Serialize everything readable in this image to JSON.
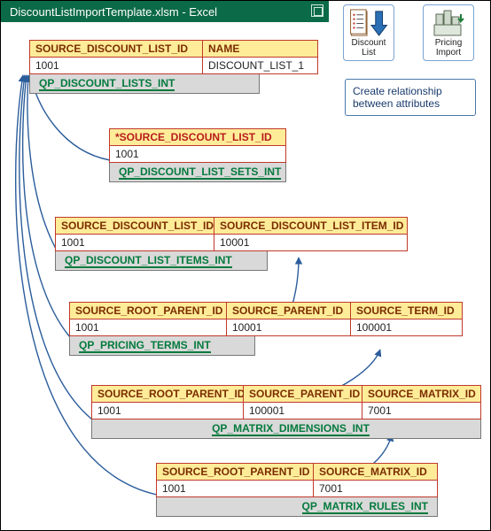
{
  "window": {
    "title": "DiscountListImportTemplate.xlsm - Excel"
  },
  "ribbon": {
    "discount_list": "Discount List",
    "pricing_import_l1": "Pricing",
    "pricing_import_l2": "Import"
  },
  "callout": {
    "line1": "Create relationship",
    "line2": "between attributes"
  },
  "tables": {
    "t1": {
      "h1": "SOURCE_DISCOUNT_LIST_ID",
      "h2": "NAME",
      "v1": "1001",
      "v2": "DISCOUNT_LIST_1",
      "name": "QP_DISCOUNT_LISTS_INT"
    },
    "t2": {
      "h1": "*SOURCE_DISCOUNT_LIST_ID",
      "v1": "1001",
      "name": "QP_DISCOUNT_LIST_SETS_INT"
    },
    "t3": {
      "h1": "SOURCE_DISCOUNT_LIST_ID",
      "h2": "SOURCE_DISCOUNT_LIST_ITEM_ID",
      "v1": "1001",
      "v2": "10001",
      "name": "QP_DISCOUNT_LIST_ITEMS_INT"
    },
    "t4": {
      "h1": "SOURCE_ROOT_PARENT_ID",
      "h2": "SOURCE_PARENT_ID",
      "h3": "SOURCE_TERM_ID",
      "v1": "1001",
      "v2": "10001",
      "v3": "100001",
      "name": "QP_PRICING_TERMS_INT"
    },
    "t5": {
      "h1": "SOURCE_ROOT_PARENT_ID",
      "h2": "SOURCE_PARENT_ID",
      "h3": "SOURCE_MATRIX_ID",
      "v1": "1001",
      "v2": "100001",
      "v3": "7001",
      "name": "QP_MATRIX_DIMENSIONS_INT"
    },
    "t6": {
      "h1": "SOURCE_ROOT_PARENT_ID",
      "h2": "SOURCE_MATRIX_ID",
      "v1": "1001",
      "v2": "7001",
      "name": "QP_MATRIX_RULES_INT"
    }
  },
  "chart_data": {
    "type": "diagram",
    "nodes": [
      {
        "id": "QP_DISCOUNT_LISTS_INT",
        "fields": {
          "SOURCE_DISCOUNT_LIST_ID": "1001",
          "NAME": "DISCOUNT_LIST_1"
        }
      },
      {
        "id": "QP_DISCOUNT_LIST_SETS_INT",
        "fields": {
          "*SOURCE_DISCOUNT_LIST_ID": "1001"
        }
      },
      {
        "id": "QP_DISCOUNT_LIST_ITEMS_INT",
        "fields": {
          "SOURCE_DISCOUNT_LIST_ID": "1001",
          "SOURCE_DISCOUNT_LIST_ITEM_ID": "10001"
        }
      },
      {
        "id": "QP_PRICING_TERMS_INT",
        "fields": {
          "SOURCE_ROOT_PARENT_ID": "1001",
          "SOURCE_PARENT_ID": "10001",
          "SOURCE_TERM_ID": "100001"
        }
      },
      {
        "id": "QP_MATRIX_DIMENSIONS_INT",
        "fields": {
          "SOURCE_ROOT_PARENT_ID": "1001",
          "SOURCE_PARENT_ID": "100001",
          "SOURCE_MATRIX_ID": "7001"
        }
      },
      {
        "id": "QP_MATRIX_RULES_INT",
        "fields": {
          "SOURCE_ROOT_PARENT_ID": "1001",
          "SOURCE_MATRIX_ID": "7001"
        }
      }
    ],
    "edges": [
      {
        "from": "QP_DISCOUNT_LIST_SETS_INT.*SOURCE_DISCOUNT_LIST_ID",
        "to": "QP_DISCOUNT_LISTS_INT.SOURCE_DISCOUNT_LIST_ID"
      },
      {
        "from": "QP_DISCOUNT_LIST_ITEMS_INT.SOURCE_DISCOUNT_LIST_ID",
        "to": "QP_DISCOUNT_LISTS_INT.SOURCE_DISCOUNT_LIST_ID"
      },
      {
        "from": "QP_PRICING_TERMS_INT.SOURCE_ROOT_PARENT_ID",
        "to": "QP_DISCOUNT_LISTS_INT.SOURCE_DISCOUNT_LIST_ID"
      },
      {
        "from": "QP_PRICING_TERMS_INT.SOURCE_PARENT_ID",
        "to": "QP_DISCOUNT_LIST_ITEMS_INT.SOURCE_DISCOUNT_LIST_ITEM_ID"
      },
      {
        "from": "QP_MATRIX_DIMENSIONS_INT.SOURCE_ROOT_PARENT_ID",
        "to": "QP_DISCOUNT_LISTS_INT.SOURCE_DISCOUNT_LIST_ID"
      },
      {
        "from": "QP_MATRIX_DIMENSIONS_INT.SOURCE_PARENT_ID",
        "to": "QP_PRICING_TERMS_INT.SOURCE_TERM_ID"
      },
      {
        "from": "QP_MATRIX_RULES_INT.SOURCE_ROOT_PARENT_ID",
        "to": "QP_DISCOUNT_LISTS_INT.SOURCE_DISCOUNT_LIST_ID"
      },
      {
        "from": "QP_MATRIX_RULES_INT.SOURCE_MATRIX_ID",
        "to": "QP_MATRIX_DIMENSIONS_INT.SOURCE_MATRIX_ID"
      }
    ]
  }
}
